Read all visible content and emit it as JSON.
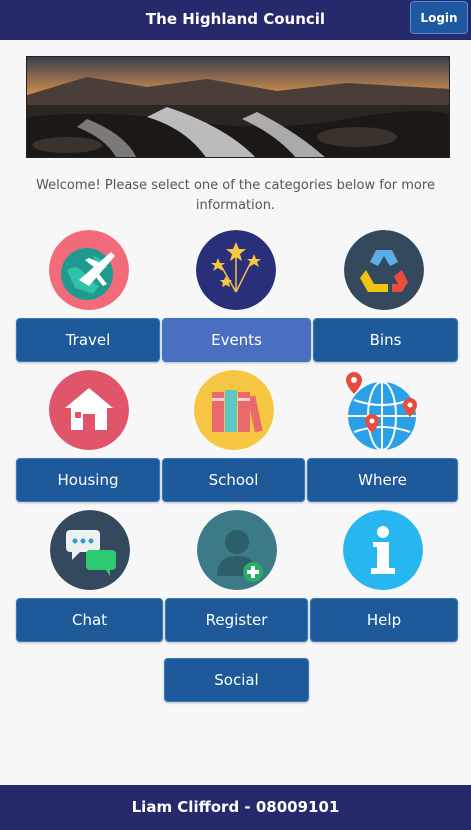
{
  "header": {
    "title": "The Highland Council",
    "login_label": "Login"
  },
  "welcome_text": "Welcome! Please select one of the categories below for more information.",
  "categories": [
    {
      "label": "Travel",
      "icon": "airplane-globe-icon",
      "selected": false
    },
    {
      "label": "Events",
      "icon": "fireworks-icon",
      "selected": true
    },
    {
      "label": "Bins",
      "icon": "recycle-icon",
      "selected": false
    },
    {
      "label": "Housing",
      "icon": "house-icon",
      "selected": false
    },
    {
      "label": "School",
      "icon": "books-icon",
      "selected": false
    },
    {
      "label": "Where",
      "icon": "map-pins-globe-icon",
      "selected": false
    },
    {
      "label": "Chat",
      "icon": "chat-bubbles-icon",
      "selected": false
    },
    {
      "label": "Register",
      "icon": "add-user-icon",
      "selected": false
    },
    {
      "label": "Help",
      "icon": "info-icon",
      "selected": false
    },
    {
      "label": "Social",
      "icon": "",
      "selected": false
    }
  ],
  "footer": {
    "text": "Liam Clifford - 08009101"
  },
  "colors": {
    "header_bg": "#27296d",
    "button_bg": "#1e5a99",
    "button_active_bg": "#4a6fc0"
  }
}
